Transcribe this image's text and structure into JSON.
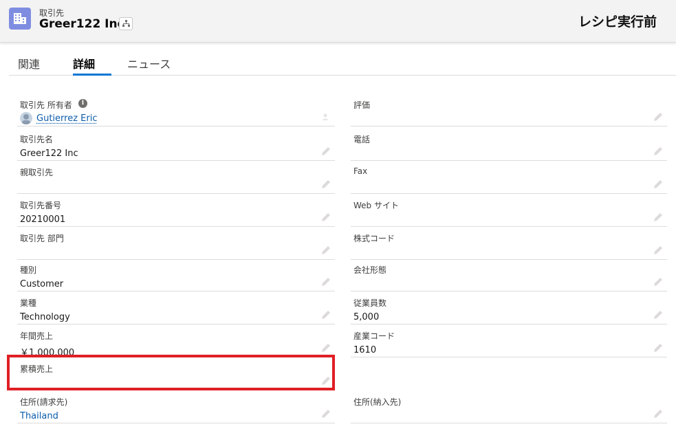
{
  "header": {
    "object_type": "取引先",
    "record_name": "Greer122 Inc",
    "banner": "レシピ実行前",
    "icon": "account-building-icon",
    "hierarchy_icon": "hierarchy-icon"
  },
  "tabs": [
    {
      "label": "関連",
      "active": false
    },
    {
      "label": "詳細",
      "active": true
    },
    {
      "label": "ニュース",
      "active": false
    }
  ],
  "fields": {
    "owner": {
      "label": "取引先 所有者",
      "value": "Gutierrez Eric"
    },
    "rating": {
      "label": "評価",
      "value": ""
    },
    "account_name": {
      "label": "取引先名",
      "value": "Greer122 Inc"
    },
    "phone": {
      "label": "電話",
      "value": ""
    },
    "parent_account": {
      "label": "親取引先",
      "value": ""
    },
    "fax": {
      "label": "Fax",
      "value": ""
    },
    "account_number": {
      "label": "取引先番号",
      "value": "20210001"
    },
    "website": {
      "label": "Web サイト",
      "value": ""
    },
    "division": {
      "label": "取引先 部門",
      "value": ""
    },
    "ticker": {
      "label": "株式コード",
      "value": ""
    },
    "type": {
      "label": "種別",
      "value": "Customer"
    },
    "ownership": {
      "label": "会社形態",
      "value": ""
    },
    "industry": {
      "label": "業種",
      "value": "Technology"
    },
    "employees": {
      "label": "従業員数",
      "value": "5,000"
    },
    "annual_revenue": {
      "label": "年間売上",
      "value": "￥1,000,000"
    },
    "sic_code": {
      "label": "産業コード",
      "value": "1610"
    },
    "cumulative_revenue": {
      "label": "累積売上",
      "value": ""
    },
    "billing_address": {
      "label": "住所(請求先)",
      "value": "Thailand"
    },
    "shipping_address": {
      "label": "住所(納入先)",
      "value": ""
    }
  },
  "colors": {
    "accent": "#0176d3",
    "link": "#0b5cab",
    "highlight": "#e01f26",
    "object_icon": "#7f8de1"
  }
}
